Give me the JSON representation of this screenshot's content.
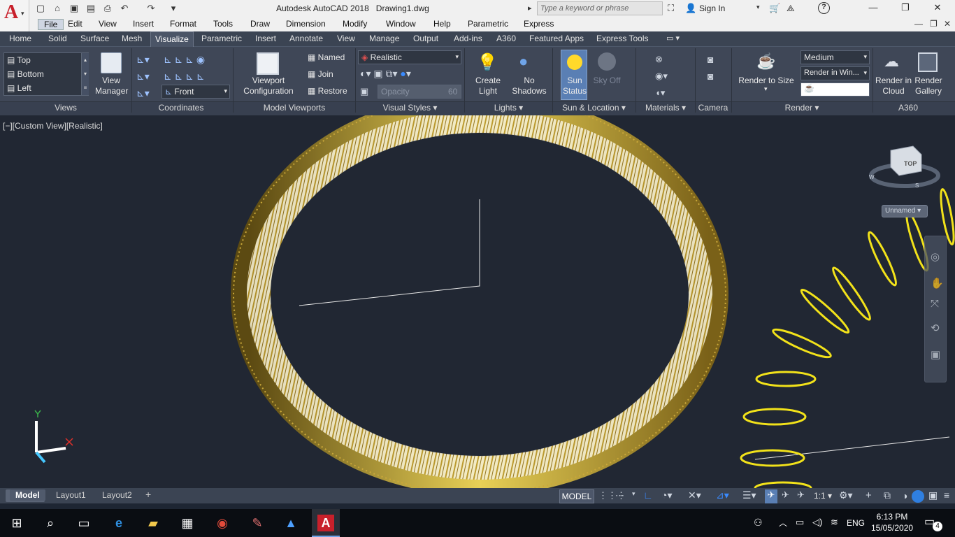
{
  "app": {
    "title": "Autodesk AutoCAD 2018",
    "document": "Drawing1.dwg",
    "search_placeholder": "Type a keyword or phrase",
    "signin": "Sign In"
  },
  "menu": [
    "File",
    "Edit",
    "View",
    "Insert",
    "Format",
    "Tools",
    "Draw",
    "Dimension",
    "Modify",
    "Window",
    "Help",
    "Parametric",
    "Express"
  ],
  "tabs": [
    "Home",
    "Solid",
    "Surface",
    "Mesh",
    "Visualize",
    "Parametric",
    "Insert",
    "Annotate",
    "View",
    "Manage",
    "Output",
    "Add-ins",
    "A360",
    "Featured Apps",
    "Express Tools"
  ],
  "active_tab": "Visualize",
  "ribbon": {
    "views": {
      "items": [
        "Top",
        "Bottom",
        "Left"
      ],
      "manager": "View Manager",
      "title": "Views"
    },
    "coordinates": {
      "combo": "Front",
      "title": "Coordinates"
    },
    "model_viewports": {
      "config": "Viewport Configuration",
      "named": "Named",
      "join": "Join",
      "restore": "Restore",
      "title": "Model Viewports"
    },
    "visual_styles": {
      "combo": "Realistic",
      "opacity_label": "Opacity",
      "opacity_value": "60",
      "title": "Visual Styles"
    },
    "lights": {
      "create": "Create Light",
      "shadows": "No Shadows",
      "title": "Lights"
    },
    "sun": {
      "status": "Sun Status",
      "sky": "Sky Off",
      "title": "Sun & Location"
    },
    "materials": {
      "title": "Materials"
    },
    "camera": {
      "title": "Camera"
    },
    "render": {
      "size": "Render to Size",
      "quality": "Medium",
      "target": "Render in Win...",
      "title": "Render"
    },
    "a360": {
      "cloud": "Render in Cloud",
      "gallery": "Render Gallery",
      "title": "A360"
    }
  },
  "viewport": {
    "label": "[−][Custom View][Realistic]",
    "viewcube_face": "TOP",
    "viewcube_dirs": {
      "w": "W",
      "s": "S"
    },
    "ucs_menu": "Unnamed",
    "ucs_x": "X",
    "ucs_y": "Y"
  },
  "layouts": [
    "Model",
    "Layout1",
    "Layout2"
  ],
  "status": {
    "model": "MODEL",
    "scale": "1:1"
  },
  "taskbar": {
    "time": "6:13 PM",
    "date": "15/05/2020",
    "lang": "ENG",
    "notifications": "4"
  }
}
